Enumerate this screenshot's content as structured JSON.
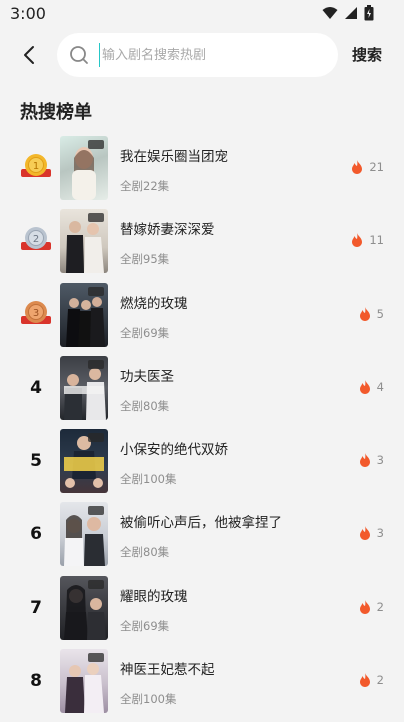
{
  "status": {
    "time": "3:00"
  },
  "header": {
    "search_placeholder": "输入剧名搜索热剧",
    "search_button": "搜索"
  },
  "section_title": "热搜榜单",
  "list": [
    {
      "rank": "1",
      "title": "我在娱乐圈当团宠",
      "episodes": "全剧22集",
      "hot": "21"
    },
    {
      "rank": "2",
      "title": "替嫁娇妻深深爱",
      "episodes": "全剧95集",
      "hot": "11"
    },
    {
      "rank": "3",
      "title": "燃烧的玫瑰",
      "episodes": "全剧69集",
      "hot": "5"
    },
    {
      "rank": "4",
      "title": "功夫医圣",
      "episodes": "全剧80集",
      "hot": "4"
    },
    {
      "rank": "5",
      "title": "小保安的绝代双娇",
      "episodes": "全剧100集",
      "hot": "3"
    },
    {
      "rank": "6",
      "title": "被偷听心声后，他被拿捏了",
      "episodes": "全剧80集",
      "hot": "3"
    },
    {
      "rank": "7",
      "title": "耀眼的玫瑰",
      "episodes": "全剧69集",
      "hot": "2"
    },
    {
      "rank": "8",
      "title": "神医王妃惹不起",
      "episodes": "全剧100集",
      "hot": "2"
    }
  ],
  "colors": {
    "accent_cursor": "#26c7c7",
    "flame": "#f2592b",
    "gold": "#f3b72a",
    "silver": "#b9c3cf",
    "bronze": "#dc8a4e",
    "ribbon": "#d9342b"
  },
  "icons": {
    "back": "chevron-left-icon",
    "search": "search-icon",
    "hot": "flame-icon",
    "medal": "medal-icon"
  }
}
